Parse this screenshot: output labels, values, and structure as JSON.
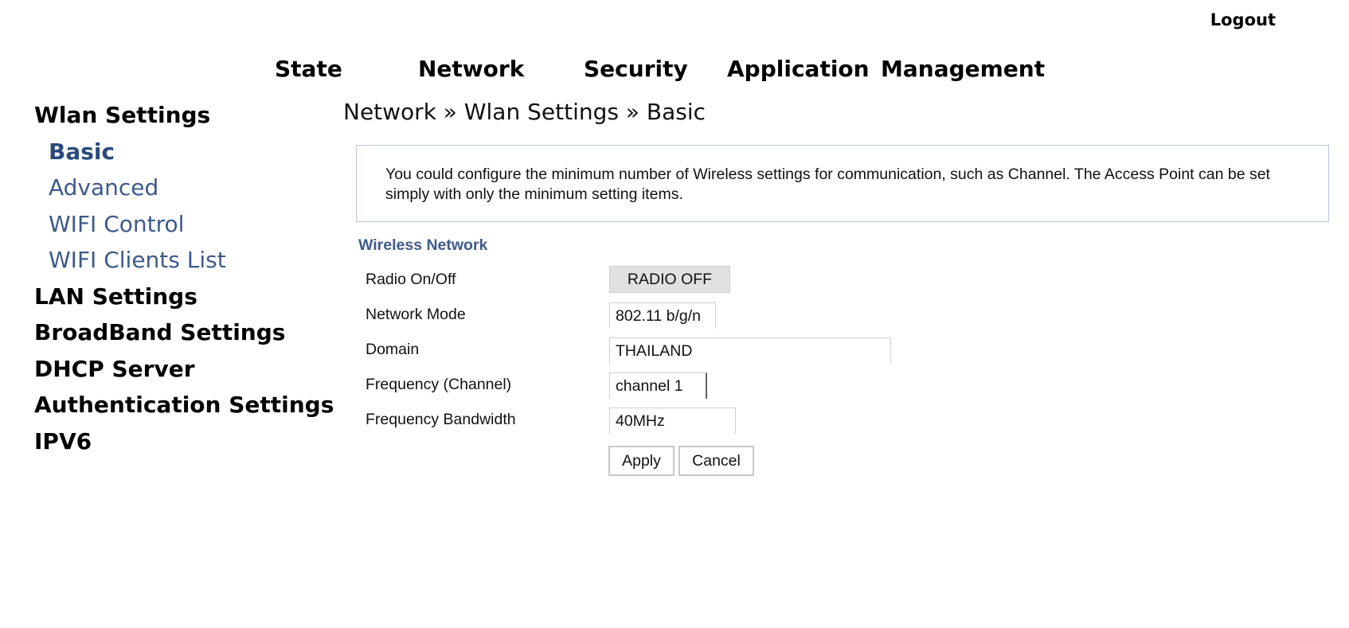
{
  "header": {
    "logout_label": "Logout"
  },
  "topnav": {
    "items": [
      {
        "label": "State"
      },
      {
        "label": "Network"
      },
      {
        "label": "Security"
      },
      {
        "label": "Application"
      },
      {
        "label": "Management"
      }
    ]
  },
  "sidebar": {
    "wlan_settings": "Wlan Settings",
    "wlan_sub": [
      {
        "label": "Basic"
      },
      {
        "label": "Advanced"
      },
      {
        "label": "WIFI Control"
      },
      {
        "label": "WIFI Clients List"
      }
    ],
    "lan_settings": "LAN Settings",
    "broadband_settings": "BroadBand Settings",
    "dhcp_server": "DHCP Server",
    "authentication_settings": "Authentication Settings",
    "ipv6": "IPV6"
  },
  "breadcrumb": "Network » Wlan Settings » Basic",
  "info_text": "You could configure the minimum number of Wireless settings for communication, such as Channel. The Access Point can be set simply with only the minimum setting items.",
  "section_title": "Wireless Network",
  "form": {
    "radio_label": "Radio On/Off",
    "radio_button": "RADIO OFF",
    "network_mode_label": "Network Mode",
    "network_mode_value": "802.11 b/g/n",
    "domain_label": "Domain",
    "domain_value": "THAILAND",
    "frequency_label": "Frequency (Channel)",
    "frequency_value": "channel 1",
    "bandwidth_label": "Frequency Bandwidth",
    "bandwidth_value": "40MHz"
  },
  "buttons": {
    "apply": "Apply",
    "cancel": "Cancel"
  }
}
